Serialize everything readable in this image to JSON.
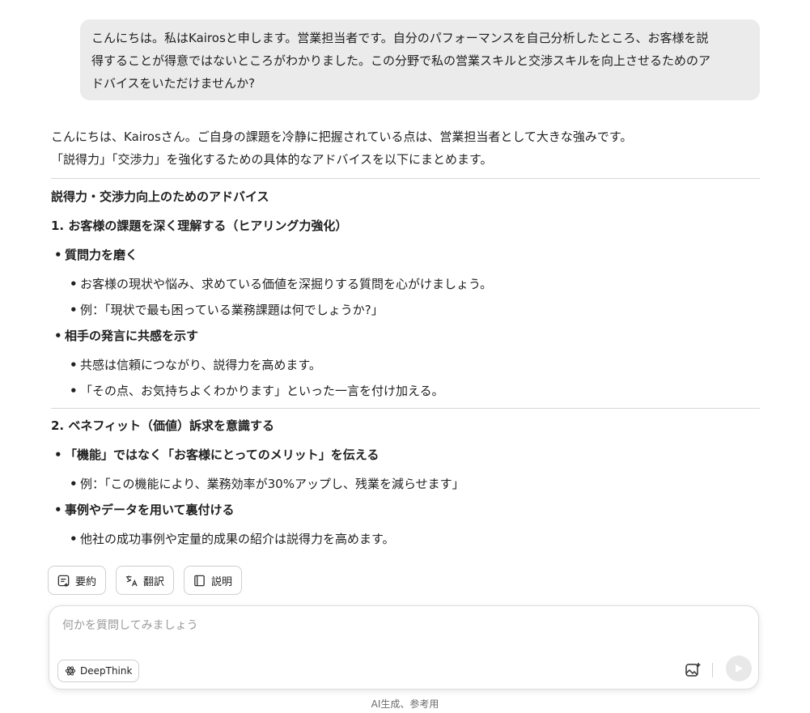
{
  "user_message": {
    "lines": [
      "こんにちは。私はKairosと申します。営業担当者です。自分のパフォーマンスを自己分析したところ、お客様を説",
      "得することが得意ではないところがわかりました。この分野で私の営業スキルと交渉スキルを向上させるためのア",
      "ドバイスをいただけませんか?"
    ]
  },
  "answer": {
    "intro": [
      "こんにちは、Kairosさん。ご自身の課題を冷静に把握されている点は、営業担当者として大きな強みです。",
      "「説得力」「交渉力」を強化するための具体的なアドバイスを以下にまとめます。"
    ],
    "title": "説得力・交渉力向上のためのアドバイス",
    "section1": {
      "heading": "1. お客様の課題を深く理解する（ヒアリング力強化）",
      "items": [
        {
          "label": "質問力を磨く",
          "sub": [
            "お客様の現状や悩み、求めている価値を深掘りする質問を心がけましょう。",
            "例：「現状で最も困っている業務課題は何でしょうか?」"
          ]
        },
        {
          "label": "相手の発言に共感を示す",
          "sub": [
            "共感は信頼につながり、説得力を高めます。",
            "「その点、お気持ちよくわかります」といった一言を付け加える。"
          ]
        }
      ]
    },
    "section2": {
      "heading": "2. ベネフィット（価値）訴求を意識する",
      "items": [
        {
          "label": "「機能」ではなく「お客様にとってのメリット」を伝える",
          "sub": [
            "例：「この機能により、業務効率が30%アップし、残業を減らせます」"
          ]
        },
        {
          "label": "事例やデータを用いて裏付ける",
          "sub": [
            "他社の成功事例や定量的成果の紹介は説得力を高めます。"
          ]
        }
      ]
    }
  },
  "actions": {
    "summary": "要約",
    "translate": "翻訳",
    "explain": "説明"
  },
  "composer": {
    "placeholder": "何かを質問してみましょう",
    "deepthink_label": "DeepThink"
  },
  "footer": "AI生成、参考用",
  "icons": {
    "summary": "summary-note-icon",
    "translate": "translate-icon",
    "explain": "book-icon",
    "deepthink": "atom-icon",
    "image": "image-upload-icon",
    "send": "send-arrow-icon"
  },
  "colors": {
    "user_bubble": "#ebebeb",
    "divider": "#d6d6d6",
    "send_button": "#e8e8e8"
  }
}
